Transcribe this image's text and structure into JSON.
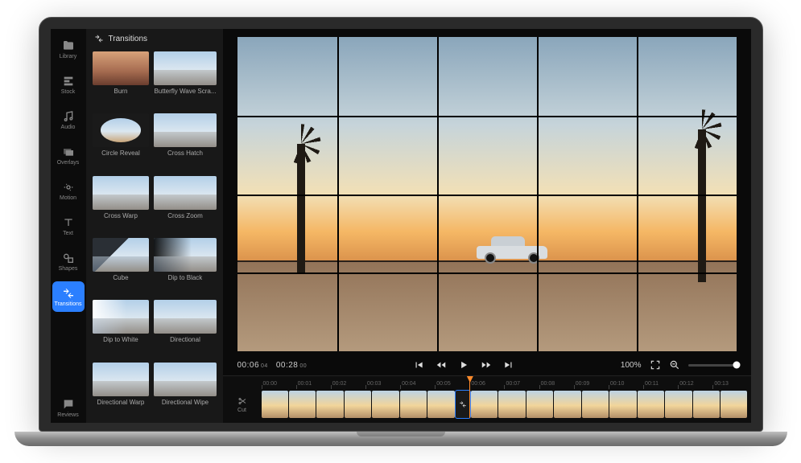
{
  "nav": {
    "items": [
      {
        "label": "Library"
      },
      {
        "label": "Stock"
      },
      {
        "label": "Audio"
      },
      {
        "label": "Overlays"
      },
      {
        "label": "Motion"
      },
      {
        "label": "Text"
      },
      {
        "label": "Shapes"
      },
      {
        "label": "Transitions"
      }
    ],
    "footer": {
      "label": "Reviews"
    },
    "active_index": 7
  },
  "panel": {
    "title": "Transitions",
    "items": [
      "Burn",
      "Butterfly Wave Scra...",
      "Circle Reveal",
      "Cross Hatch",
      "Cross Warp",
      "Cross Zoom",
      "Cube",
      "Dip to Black",
      "Dip to White",
      "Directional",
      "Directional Warp",
      "Directional Wipe"
    ]
  },
  "playback": {
    "current": "00:06",
    "current_frames": "04",
    "total": "00:28",
    "total_frames": "00",
    "zoom": "100%"
  },
  "timeline": {
    "cut_label": "Cut",
    "ticks": [
      "00:00",
      "00:01",
      "00:02",
      "00:03",
      "00:04",
      "00:05",
      "00:06",
      "00:07",
      "00:08",
      "00:09",
      "00:10",
      "00:11",
      "00:12",
      "00:13"
    ],
    "playhead_tick_index": 6,
    "clip_count": 17,
    "transition_at_clip": 7
  },
  "colors": {
    "accent": "#2b7fff",
    "playhead": "#ff8a2a"
  }
}
